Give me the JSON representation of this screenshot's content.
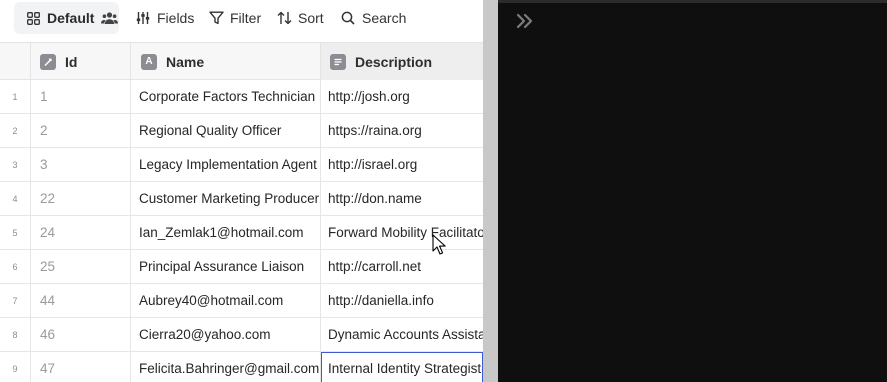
{
  "toolbar": {
    "view_label": "Default",
    "fields_label": "Fields",
    "filter_label": "Filter",
    "sort_label": "Sort",
    "search_label": "Search"
  },
  "columns": {
    "id": "Id",
    "name": "Name",
    "description": "Description"
  },
  "rows": [
    {
      "num": "1",
      "id": "1",
      "name": "Corporate Factors Technician",
      "description": "http://josh.org"
    },
    {
      "num": "2",
      "id": "2",
      "name": "Regional Quality Officer",
      "description": "https://raina.org"
    },
    {
      "num": "3",
      "id": "3",
      "name": "Legacy Implementation Agent",
      "description": "http://israel.org"
    },
    {
      "num": "4",
      "id": "22",
      "name": "Customer Marketing Producer",
      "description": "http://don.name"
    },
    {
      "num": "5",
      "id": "24",
      "name": "Ian_Zemlak1@hotmail.com",
      "description": "Forward Mobility Facilitator"
    },
    {
      "num": "6",
      "id": "25",
      "name": "Principal Assurance Liaison",
      "description": "http://carroll.net"
    },
    {
      "num": "7",
      "id": "44",
      "name": "Aubrey40@hotmail.com",
      "description": "http://daniella.info"
    },
    {
      "num": "8",
      "id": "46",
      "name": "Cierra20@yahoo.com",
      "description": "Dynamic Accounts Assistant"
    },
    {
      "num": "9",
      "id": "47",
      "name": "Felicita.Bahringer@gmail.com",
      "description": "Internal Identity Strategist"
    }
  ],
  "colors": {
    "accent": "#3e59d6",
    "right_pane_bg": "#0f0f0f",
    "divider": "#c8c8c8"
  }
}
